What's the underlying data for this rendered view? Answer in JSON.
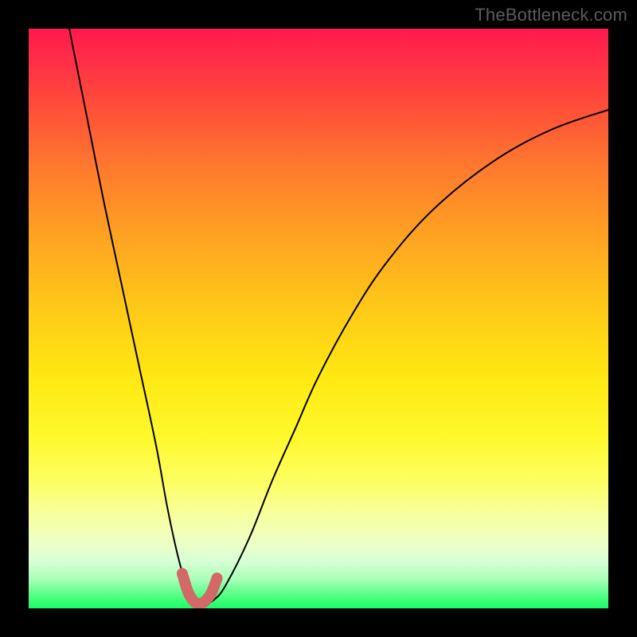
{
  "watermark": "TheBottleneck.com",
  "colors": {
    "background": "#000000",
    "curve": "#000000",
    "marker": "#d26868",
    "marker_fill": "#cf6b6b"
  },
  "chart_data": {
    "type": "line",
    "title": "",
    "xlabel": "",
    "ylabel": "",
    "xlim": [
      0,
      100
    ],
    "ylim": [
      0,
      100
    ],
    "grid": false,
    "legend": false,
    "series": [
      {
        "name": "bottleneck-curve",
        "x": [
          7,
          10,
          13,
          16,
          19,
          22,
          24,
          26,
          27.5,
          29,
          30.5,
          32,
          34,
          38,
          42,
          46,
          50,
          56,
          62,
          70,
          80,
          90,
          100
        ],
        "y": [
          100,
          85,
          70,
          56,
          42,
          28,
          17,
          8,
          3.5,
          1.2,
          0.8,
          1.5,
          4,
          12,
          22,
          31,
          40,
          51,
          60,
          69,
          77,
          82.5,
          86
        ]
      },
      {
        "name": "valley-marker",
        "x": [
          26.5,
          27.5,
          28.5,
          29.5,
          30.5,
          31.5,
          32.5
        ],
        "y": [
          6.0,
          2.8,
          1.2,
          0.8,
          1.3,
          2.6,
          5.2
        ]
      }
    ]
  }
}
